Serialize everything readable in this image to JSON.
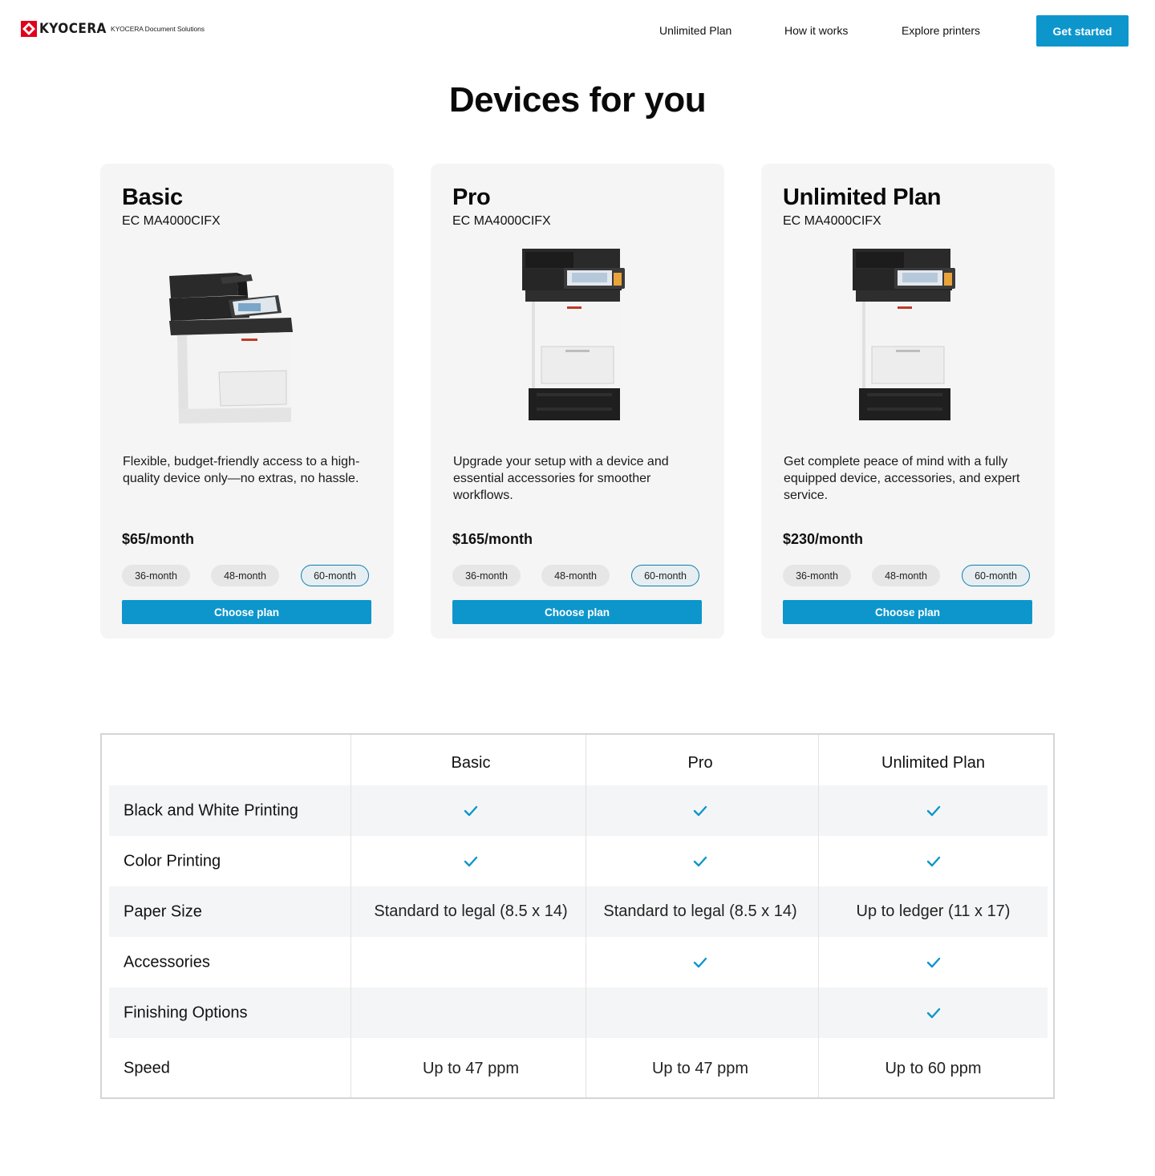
{
  "header": {
    "brand": "KYOCERA",
    "brand_sub": "KYOCERA Document Solutions",
    "nav": [
      "Unlimited Plan",
      "How it works",
      "Explore printers"
    ],
    "cta": "Get started"
  },
  "page_title": "Devices for you",
  "cards": [
    {
      "name": "Basic",
      "model": "EC MA4000CIFX",
      "description": "Flexible, budget-friendly access to a high-quality device only—no extras, no hassle.",
      "price": "$65/month",
      "terms": [
        "36-month",
        "48-month",
        "60-month"
      ],
      "selected_term": "60-month",
      "button": "Choose plan"
    },
    {
      "name": "Pro",
      "model": "EC MA4000CIFX",
      "description": "Upgrade your setup with a device and essential accessories for smoother workflows.",
      "price": "$165/month",
      "terms": [
        "36-month",
        "48-month",
        "60-month"
      ],
      "selected_term": "60-month",
      "button": "Choose plan"
    },
    {
      "name": "Unlimited Plan",
      "model": "EC MA4000CIFX",
      "description": "Get complete peace of mind with a fully equipped device, accessories, and expert service.",
      "price": "$230/month",
      "terms": [
        "36-month",
        "48-month",
        "60-month"
      ],
      "selected_term": "60-month",
      "button": "Choose plan"
    }
  ],
  "comparison": {
    "headers": [
      "",
      "Basic",
      "Pro",
      "Unlimited Plan"
    ],
    "rows": [
      {
        "label": "Black and White Printing",
        "values": [
          "check",
          "check",
          "check"
        ]
      },
      {
        "label": "Color Printing",
        "values": [
          "check",
          "check",
          "check"
        ]
      },
      {
        "label": "Paper Size",
        "values": [
          "Standard to legal (8.5 x 14)",
          "Standard to legal (8.5 x 14)",
          "Up to ledger (11 x 17)"
        ]
      },
      {
        "label": "Accessories",
        "values": [
          "",
          "check",
          "check"
        ]
      },
      {
        "label": "Finishing Options",
        "values": [
          "",
          "",
          "check"
        ]
      },
      {
        "label": "Speed",
        "values": [
          "Up to 47 ppm",
          "Up to 47 ppm",
          "Up to 60 ppm"
        ]
      }
    ]
  },
  "colors": {
    "accent": "#0d96cc",
    "brand_red": "#e2001a",
    "card_bg": "#f5f5f5",
    "row_shade": "#f4f5f6"
  }
}
